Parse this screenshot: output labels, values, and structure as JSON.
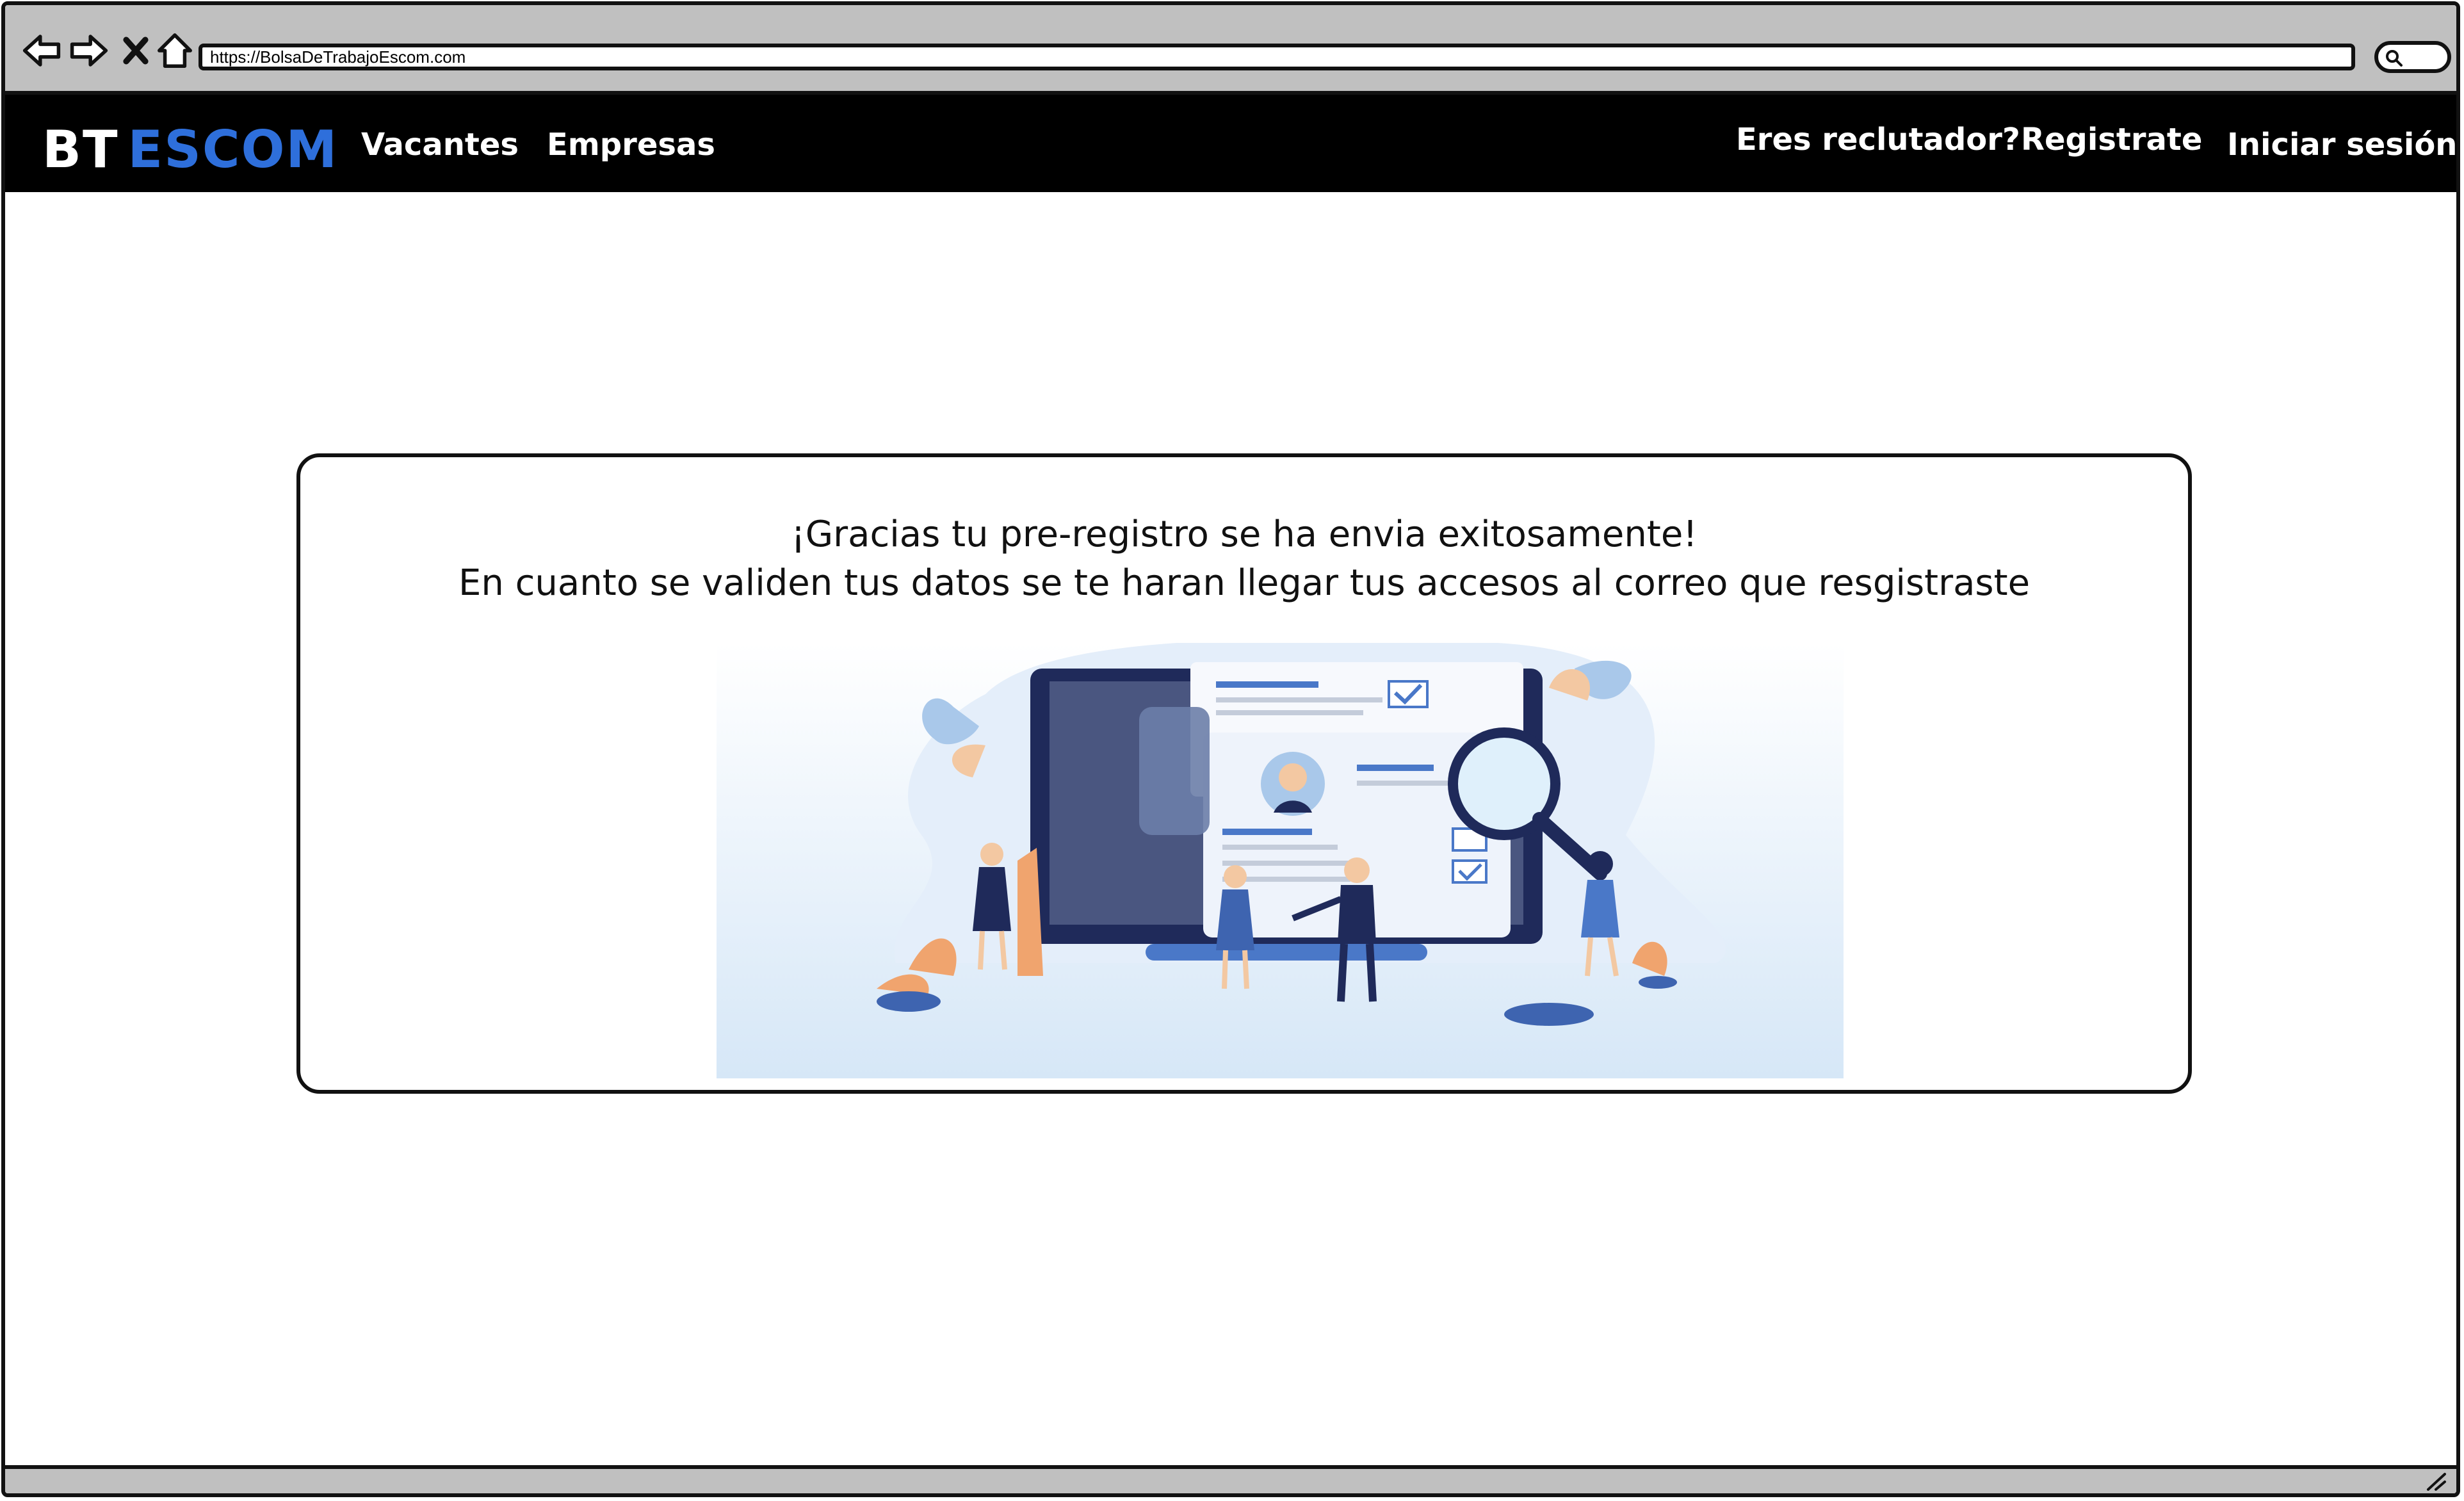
{
  "browser": {
    "url": "https://BolsaDeTrabajoEscom.com",
    "icons": [
      "back-arrow-icon",
      "forward-arrow-icon",
      "close-icon",
      "home-icon",
      "search-icon"
    ]
  },
  "header": {
    "logo_part1": "BT",
    "logo_part2": "ESCOM",
    "nav": {
      "vacantes": "Vacantes",
      "empresas": "Empresas",
      "reclutador": "Eres reclutador?",
      "registrate": "Registrate",
      "iniciar_sesion": "Iniciar sesión"
    }
  },
  "main": {
    "message_line1": "¡Gracias tu pre-registro se ha envia exitosamente!",
    "message_line2": "En cuanto se validen tus datos se te haran llegar tus accesos al correo que resgistraste"
  },
  "colors": {
    "header_bg": "#000000",
    "logo_accent": "#2e6fdb",
    "chrome_bg": "#c0c0c0",
    "illustration_dark": "#1f2a5a",
    "illustration_light": "#dbe9f7"
  }
}
